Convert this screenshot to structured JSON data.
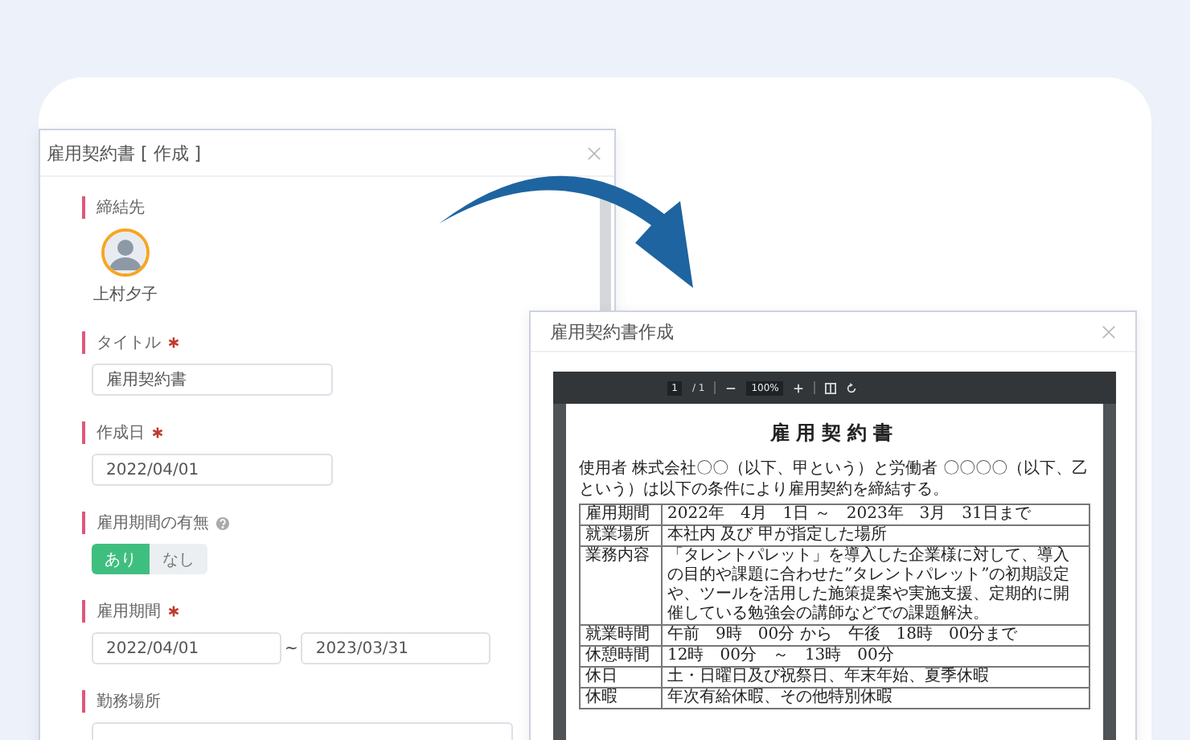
{
  "editor_dialog": {
    "title": "雇用契約書 [ 作成 ]",
    "fields": [
      {
        "kind": "avatar",
        "label": "締結先",
        "name": "上村夕子"
      },
      {
        "kind": "text",
        "label": "タイトル",
        "required": true,
        "value": "雇用契約書"
      },
      {
        "kind": "text",
        "label": "作成日",
        "required": true,
        "value": "2022/04/01"
      },
      {
        "kind": "toggle",
        "label": "雇用期間の有無",
        "help": true,
        "options": [
          {
            "label": "あり",
            "selected": true
          },
          {
            "label": "なし",
            "selected": false
          }
        ]
      },
      {
        "kind": "range",
        "label": "雇用期間",
        "required": true,
        "from": "2022/04/01",
        "separator": "~",
        "to": "2023/03/31"
      },
      {
        "kind": "textarea",
        "label": "勤務場所"
      }
    ]
  },
  "preview_dialog": {
    "title": "雇用契約書作成",
    "pdf_toolbar": {
      "page": "1",
      "page_total": "/ 1",
      "zoom": "100%"
    },
    "document": {
      "title": "雇用契約書",
      "intro": "使用者 株式会社〇〇（以下、甲という）と労働者 〇〇〇〇（以下、乙という）は以下の条件により雇用契約を締結する。",
      "rows": [
        {
          "label": "雇用期間",
          "value": "2022年　4月　1日 ～　2023年　3月　31日まで"
        },
        {
          "label": "就業場所",
          "value": "本社内 及び 甲が指定した場所"
        },
        {
          "label": "業務内容",
          "value": "「タレントパレット」を導入した企業様に対して、導入の目的や課題に合わせた”タレントパレット”の初期設定や、ツールを活用した施策提案や実施支援、定期的に開催している勉強会の講師などでの課題解決。"
        },
        {
          "label": "就業時間",
          "value": "午前　9時　00分 から　午後　18時　00分まで"
        },
        {
          "label": "休憩時間",
          "value": "12時　00分　～　13時　00分"
        },
        {
          "label": "休日",
          "value": "土・日曜日及び祝祭日、年末年始、夏季休暇"
        },
        {
          "label": "休暇",
          "value": "年次有給休暇、その他特別休暇"
        }
      ]
    }
  }
}
